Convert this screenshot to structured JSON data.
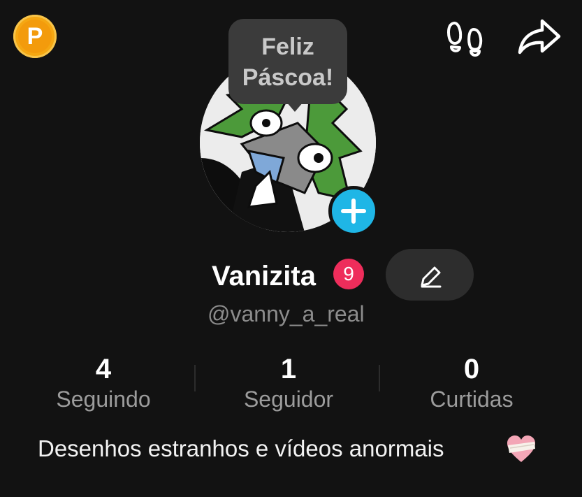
{
  "top_bar": {
    "coin_letter": "P",
    "icons": [
      "coin-icon",
      "footprints-icon",
      "share-icon"
    ]
  },
  "tooltip": {
    "line1": "Feliz",
    "line2": "Páscoa!"
  },
  "profile": {
    "display_name": "Vanizita",
    "badge_count": "9",
    "username": "@vanny_a_real",
    "add_avatar_icon": "plus-icon",
    "edit_icon": "pencil-icon"
  },
  "stats": [
    {
      "value": "4",
      "label": "Seguindo"
    },
    {
      "value": "1",
      "label": "Seguidor"
    },
    {
      "value": "0",
      "label": "Curtidas"
    }
  ],
  "bio": {
    "text": "Desenhos estranhos e vídeos anormais",
    "emoji_icon": "bandaged-heart-icon"
  },
  "colors": {
    "background": "#121212",
    "accent_blue": "#1fb6e6",
    "badge_red": "#ee2d5b",
    "coin_gold": "#f5a712",
    "muted_text": "#8c8c8c"
  }
}
